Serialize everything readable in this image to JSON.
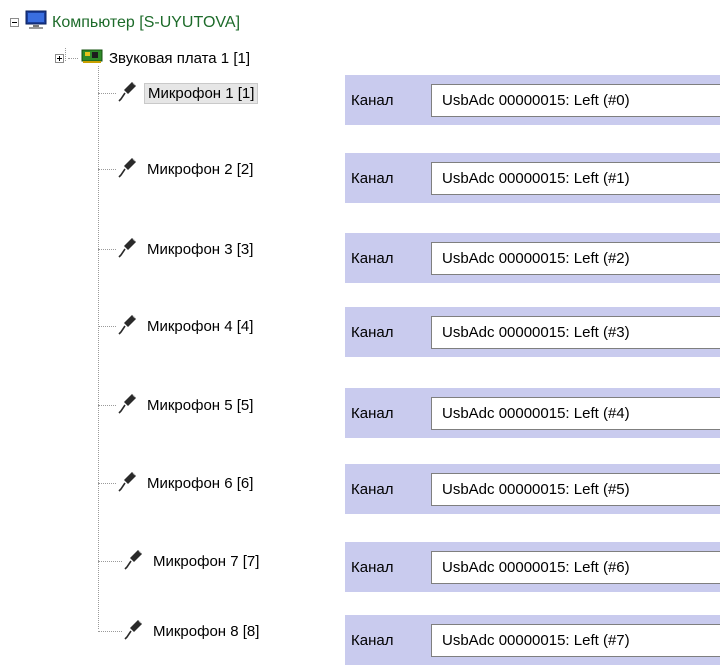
{
  "tree": {
    "root": {
      "label": "Компьютер [S-UYUTOVA]",
      "icon": "monitor-icon"
    },
    "card": {
      "label": "Звуковая плата 1 [1]",
      "icon": "sound-card-icon"
    },
    "microphones": [
      {
        "label": "Микрофон 1 [1]",
        "selected": true
      },
      {
        "label": "Микрофон 2 [2]"
      },
      {
        "label": "Микрофон 3 [3]"
      },
      {
        "label": "Микрофон 4 [4]"
      },
      {
        "label": "Микрофон 5 [5]"
      },
      {
        "label": "Микрофон 6 [6]"
      },
      {
        "label": "Микрофон 7 [7]"
      },
      {
        "label": "Микрофон 8 [8]"
      }
    ]
  },
  "channels": [
    {
      "label": "Канал",
      "value": "UsbAdc 00000015: Left (#0)"
    },
    {
      "label": "Канал",
      "value": "UsbAdc 00000015: Left (#1)"
    },
    {
      "label": "Канал",
      "value": "UsbAdc 00000015: Left (#2)"
    },
    {
      "label": "Канал",
      "value": "UsbAdc 00000015: Left (#3)"
    },
    {
      "label": "Канал",
      "value": "UsbAdc 00000015: Left (#4)"
    },
    {
      "label": "Канал",
      "value": "UsbAdc 00000015: Left (#5)"
    },
    {
      "label": "Канал",
      "value": "UsbAdc 00000015: Left (#6)"
    },
    {
      "label": "Канал",
      "value": "UsbAdc 00000015: Left (#7)"
    }
  ],
  "colors": {
    "panel": "#c9cbee",
    "root_text": "#1d6b2a"
  }
}
